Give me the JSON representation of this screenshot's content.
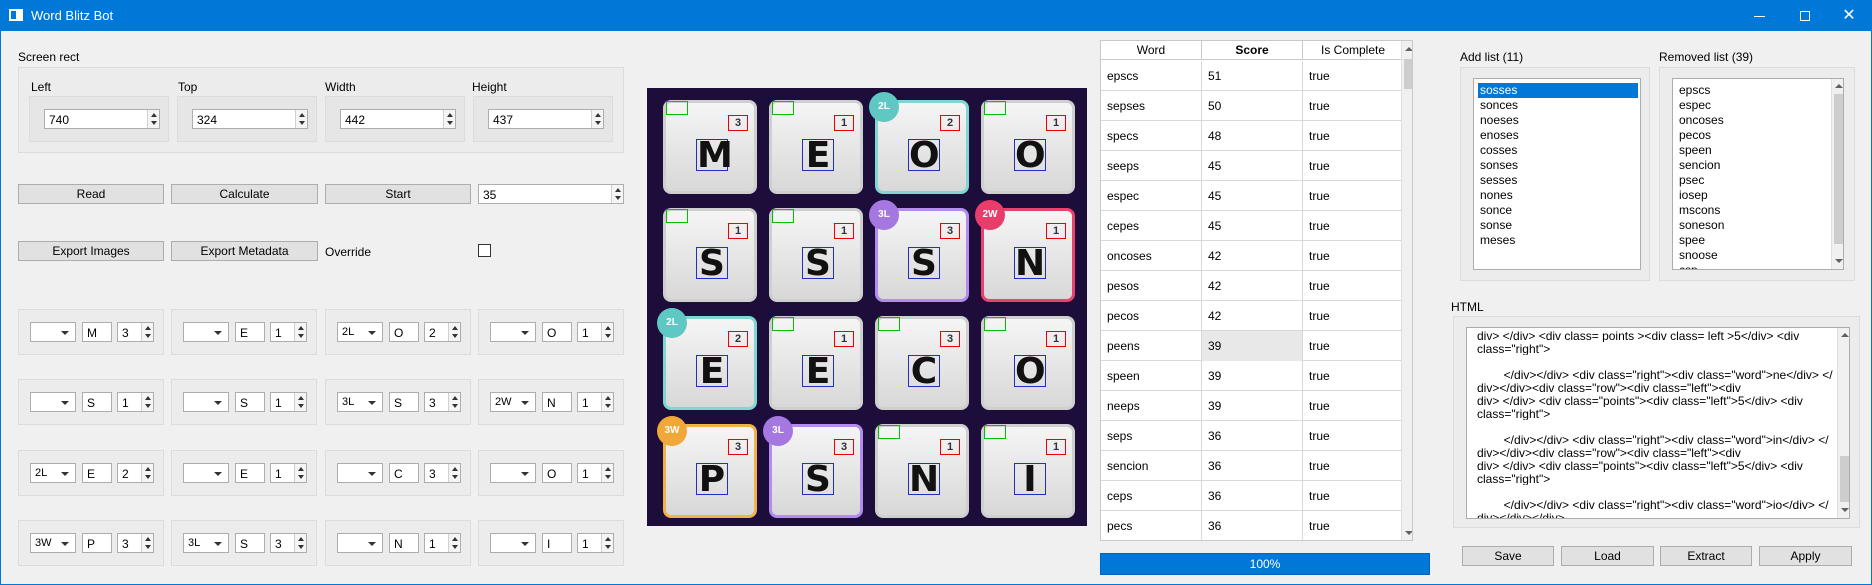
{
  "window": {
    "title": "Word Blitz Bot",
    "minimize": "—",
    "close": "✕"
  },
  "screen_rect": {
    "group_label": "Screen rect",
    "left": {
      "label": "Left",
      "value": "740"
    },
    "top": {
      "label": "Top",
      "value": "324"
    },
    "width": {
      "label": "Width",
      "value": "442"
    },
    "height": {
      "label": "Height",
      "value": "437"
    }
  },
  "actions": {
    "read": "Read",
    "calculate": "Calculate",
    "start": "Start",
    "start_value": "35",
    "export_images": "Export Images",
    "export_metadata": "Export Metadata",
    "override": "Override"
  },
  "grid_rows": [
    [
      {
        "mod": "",
        "letter": "M",
        "score": "3"
      },
      {
        "mod": "",
        "letter": "E",
        "score": "1"
      },
      {
        "mod": "2L",
        "letter": "O",
        "score": "2"
      },
      {
        "mod": "",
        "letter": "O",
        "score": "1"
      }
    ],
    [
      {
        "mod": "",
        "letter": "S",
        "score": "1"
      },
      {
        "mod": "",
        "letter": "S",
        "score": "1"
      },
      {
        "mod": "3L",
        "letter": "S",
        "score": "3"
      },
      {
        "mod": "2W",
        "letter": "N",
        "score": "1"
      }
    ],
    [
      {
        "mod": "2L",
        "letter": "E",
        "score": "2"
      },
      {
        "mod": "",
        "letter": "E",
        "score": "1"
      },
      {
        "mod": "",
        "letter": "C",
        "score": "3"
      },
      {
        "mod": "",
        "letter": "O",
        "score": "1"
      }
    ],
    [
      {
        "mod": "3W",
        "letter": "P",
        "score": "3"
      },
      {
        "mod": "3L",
        "letter": "S",
        "score": "3"
      },
      {
        "mod": "",
        "letter": "N",
        "score": "1"
      },
      {
        "mod": "",
        "letter": "I",
        "score": "1"
      }
    ]
  ],
  "board": {
    "badge_colors": {
      "2L": "#5fc8c4",
      "3L": "#a478e0",
      "2W": "#e83c6a",
      "3W": "#f0a838"
    },
    "border_colors": {
      "2L": "#7fd6d2",
      "3L": "#b48cf0",
      "2W": "#e8426e",
      "3W": "#f2b24a"
    }
  },
  "table": {
    "headers": [
      "Word",
      "Score",
      "Is Complete"
    ],
    "rows": [
      [
        "epscs",
        "51",
        "true"
      ],
      [
        "sepses",
        "50",
        "true"
      ],
      [
        "specs",
        "48",
        "true"
      ],
      [
        "seeps",
        "45",
        "true"
      ],
      [
        "espec",
        "45",
        "true"
      ],
      [
        "cepes",
        "45",
        "true"
      ],
      [
        "oncoses",
        "42",
        "true"
      ],
      [
        "pesos",
        "42",
        "true"
      ],
      [
        "pecos",
        "42",
        "true"
      ],
      [
        "peens",
        "39",
        "true"
      ],
      [
        "speen",
        "39",
        "true"
      ],
      [
        "neeps",
        "39",
        "true"
      ],
      [
        "seps",
        "36",
        "true"
      ],
      [
        "sencion",
        "36",
        "true"
      ],
      [
        "ceps",
        "36",
        "true"
      ],
      [
        "pecs",
        "36",
        "true"
      ]
    ]
  },
  "progress": {
    "text": "100%",
    "value": 100
  },
  "add_list": {
    "label": "Add list (11)",
    "items": [
      "sosses",
      "sonces",
      "noeses",
      "enoses",
      "cosses",
      "sonses",
      "sesses",
      "nones",
      "sonce",
      "sonse",
      "meses"
    ]
  },
  "removed_list": {
    "label": "Removed list (39)",
    "items": [
      "epscs",
      "espec",
      "oncoses",
      "pecos",
      "speen",
      "sencion",
      "psec",
      "iosep",
      "mscons",
      "soneson",
      "spee",
      "snoose",
      "csp"
    ]
  },
  "html_panel": {
    "label": "HTML",
    "lines": [
      "div> </div> <div class= points ><div class= left >5</div> <div",
      "class=\"right\">",
      "",
      "        </div></div> <div class=\"right\"><div class=\"word\">ne</div> </",
      "div></div><div class=\"row\"><div class=\"left\"><div class=\"word\">in</",
      "div> </div> <div class=\"points\"><div class=\"left\">5</div> <div",
      "class=\"right\">",
      "",
      "        </div></div> <div class=\"right\"><div class=\"word\">in</div> </",
      "div></div><div class=\"row\"><div class=\"left\"><div class=\"word\">io</",
      "div> </div> <div class=\"points\"><div class=\"left\">5</div> <div",
      "class=\"right\">",
      "",
      "        </div></div> <div class=\"right\"><div class=\"word\">io</div> </",
      "div></div></div>"
    ]
  },
  "bottom_buttons": {
    "save": "Save",
    "load": "Load",
    "extract": "Extract",
    "apply": "Apply"
  }
}
